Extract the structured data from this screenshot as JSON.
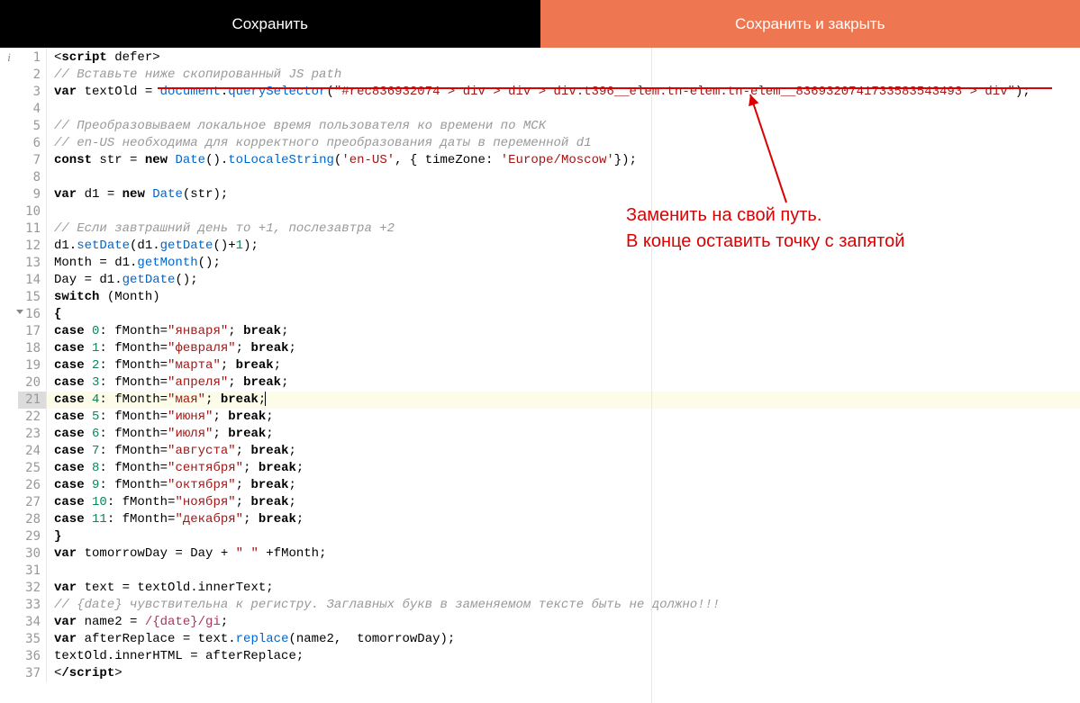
{
  "toolbar": {
    "save": "Сохранить",
    "save_close": "Сохранить и закрыть"
  },
  "info_glyph": "i",
  "anno": {
    "line1": "Заменить на свой путь.",
    "line2": "В конце оставить точку с запятой"
  },
  "lines": {
    "l1_a": "<",
    "l1_b": "script",
    "l1_c": " defer>",
    "l2": "// Вставьте ниже скопированный JS path",
    "l3_a": "var",
    "l3_b": " textOld = ",
    "l3_c": "document",
    "l3_d": ".",
    "l3_e": "querySelector",
    "l3_f": "(",
    "l3_g": "\"#rec836932074 > div > div > div.t396__elem.tn-elem.tn-elem__8369320741733583543493 > div\"",
    "l3_h": ");",
    "l5": "// Преобразовываем локальное время пользователя ко времени по МСК",
    "l6": "// en-US необходима для корректного преобразования даты в переменной d1",
    "l7_a": "const",
    "l7_b": " str = ",
    "l7_c": "new",
    "l7_d": " Date",
    "l7_e": "().",
    "l7_f": "toLocaleString",
    "l7_g": "(",
    "l7_h": "'en-US'",
    "l7_i": ", { timeZone: ",
    "l7_j": "'Europe/Moscow'",
    "l7_k": "});",
    "l9_a": "var",
    "l9_b": " d1 = ",
    "l9_c": "new",
    "l9_d": " Date",
    "l9_e": "(str);",
    "l11": "// Если завтрашний день то +1, послезавтра +2",
    "l12_a": "d1.",
    "l12_b": "setDate",
    "l12_c": "(d1.",
    "l12_d": "getDate",
    "l12_e": "()+",
    "l12_f": "1",
    "l12_g": ");",
    "l13_a": "Month = d1.",
    "l13_b": "getMonth",
    "l13_c": "();",
    "l14_a": "Day = d1.",
    "l14_b": "getDate",
    "l14_c": "();",
    "l15_a": "switch",
    "l15_b": " (Month)",
    "l16": "{",
    "c17a": "case",
    "c17n": " 0",
    "c17b": ": fMonth=",
    "c17s": "\"января\"",
    "c17c": "; ",
    "c17d": "break",
    "c17e": ";",
    "c18a": "case",
    "c18n": " 1",
    "c18b": ": fMonth=",
    "c18s": "\"февраля\"",
    "c18c": "; ",
    "c18d": "break",
    "c18e": ";",
    "c19a": "case",
    "c19n": " 2",
    "c19b": ": fMonth=",
    "c19s": "\"марта\"",
    "c19c": "; ",
    "c19d": "break",
    "c19e": ";",
    "c20a": "case",
    "c20n": " 3",
    "c20b": ": fMonth=",
    "c20s": "\"апреля\"",
    "c20c": "; ",
    "c20d": "break",
    "c20e": ";",
    "c21a": "case",
    "c21n": " 4",
    "c21b": ": fMonth=",
    "c21s": "\"мая\"",
    "c21c": "; ",
    "c21d": "break",
    "c21e": ";",
    "c22a": "case",
    "c22n": " 5",
    "c22b": ": fMonth=",
    "c22s": "\"июня\"",
    "c22c": "; ",
    "c22d": "break",
    "c22e": ";",
    "c23a": "case",
    "c23n": " 6",
    "c23b": ": fMonth=",
    "c23s": "\"июля\"",
    "c23c": "; ",
    "c23d": "break",
    "c23e": ";",
    "c24a": "case",
    "c24n": " 7",
    "c24b": ": fMonth=",
    "c24s": "\"августа\"",
    "c24c": "; ",
    "c24d": "break",
    "c24e": ";",
    "c25a": "case",
    "c25n": " 8",
    "c25b": ": fMonth=",
    "c25s": "\"сентября\"",
    "c25c": "; ",
    "c25d": "break",
    "c25e": ";",
    "c26a": "case",
    "c26n": " 9",
    "c26b": ": fMonth=",
    "c26s": "\"октября\"",
    "c26c": "; ",
    "c26d": "break",
    "c26e": ";",
    "c27a": "case",
    "c27n": " 10",
    "c27b": ": fMonth=",
    "c27s": "\"ноября\"",
    "c27c": "; ",
    "c27d": "break",
    "c27e": ";",
    "c28a": "case",
    "c28n": " 11",
    "c28b": ": fMonth=",
    "c28s": "\"декабря\"",
    "c28c": "; ",
    "c28d": "break",
    "c28e": ";",
    "l29": "}",
    "l30_a": "var",
    "l30_b": " tomorrowDay = Day + ",
    "l30_c": "\" \"",
    "l30_d": " +fMonth;",
    "l32_a": "var",
    "l32_b": " text = textOld.innerText;",
    "l33": "// {date} чувствительна к регистру. Заглавных букв в заменяемом тексте быть не должно!!!",
    "l34_a": "var",
    "l34_b": " name2 = ",
    "l34_c": "/{date}/gi",
    "l34_d": ";",
    "l35_a": "var",
    "l35_b": " afterReplace = text.",
    "l35_c": "replace",
    "l35_d": "(name2,  tomorrowDay);",
    "l36": "textOld.innerHTML = afterReplace;",
    "l37_a": "<",
    "l37_b": "/script",
    "l37_c": ">"
  },
  "line_numbers": [
    "1",
    "2",
    "3",
    "4",
    "5",
    "6",
    "7",
    "8",
    "9",
    "10",
    "11",
    "12",
    "13",
    "14",
    "15",
    "16",
    "17",
    "18",
    "19",
    "20",
    "21",
    "22",
    "23",
    "24",
    "25",
    "26",
    "27",
    "28",
    "29",
    "30",
    "31",
    "32",
    "33",
    "34",
    "35",
    "36",
    "37"
  ]
}
